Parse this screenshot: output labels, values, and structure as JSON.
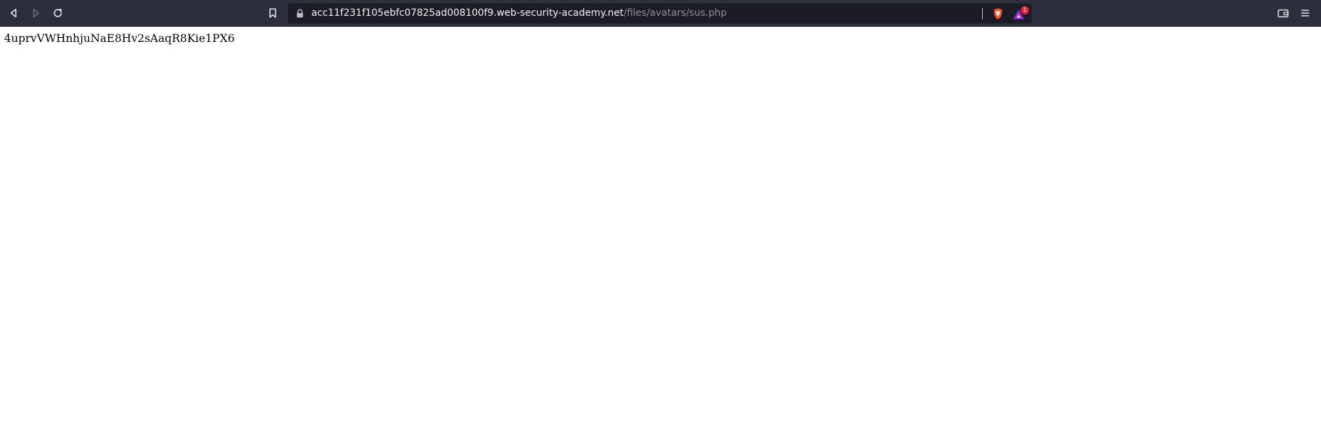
{
  "browser": {
    "url": {
      "host": "acc11f231f105ebfc07825ad008100f9.web-security-academy.net",
      "path": "/files/avatars/sus.php"
    },
    "rewards_badge_count": "1",
    "icons": {
      "back": "back-arrow-icon",
      "forward": "forward-arrow-icon",
      "reload": "reload-icon",
      "bookmark": "bookmark-icon",
      "lock": "lock-icon",
      "shields": "brave-shields-icon",
      "rewards": "brave-rewards-icon",
      "wallet": "wallet-icon",
      "menu": "hamburger-menu-icon"
    },
    "colors": {
      "toolbar": "#2b2e3b",
      "urlbar": "#1b1c25",
      "shield": "#fb542b",
      "rewards_badge": "#e5233e"
    }
  },
  "page": {
    "body_text": "4uprvVWHnhjuNaE8Hv2sAaqR8Kie1PX6"
  }
}
